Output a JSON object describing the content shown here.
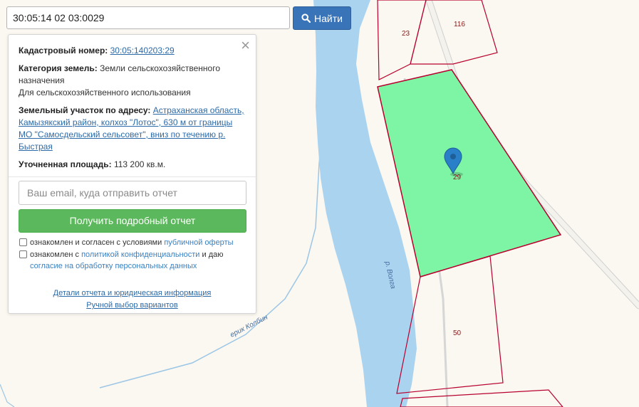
{
  "search": {
    "value": "30:05:14 02 03:0029",
    "button_label": "Найти"
  },
  "card": {
    "cadastral_label": "Кадастровый номер:",
    "cadastral_number": "30:05:140203:29",
    "category_label": "Категория земель:",
    "category_value": "Земли сельскохозяйственного назначения",
    "usage": "Для сельскохозяйственного использования",
    "address_label": "Земельный участок по адресу:",
    "address_value": "Астраханская область, Камызякский район, колхоз \"Лотос\", 630 м от границы МО \"Самосдельский сельсовет\", вниз по течению р. Быстрая",
    "area_label": "Уточненная площадь:",
    "area_value": "113 200 кв.м.",
    "email_placeholder": "Ваш email, куда отправить отчет",
    "report_button": "Получить подробный отчет",
    "consent1_prefix": "ознакомлен и согласен с условиями",
    "consent1_link": "публичной оферты",
    "consent2_prefix": "ознакомлен с",
    "consent2_link": "политикой конфиденциальности",
    "consent2_mid": "и даю",
    "consent2_link2": "согласие на обработку персональных данных",
    "details_link": "Детали отчета и юридическая информация",
    "manual_link": "Ручной выбор вариантов"
  },
  "map": {
    "parcel_labels": [
      "23",
      "116",
      "29",
      "50"
    ],
    "water_labels": [
      "р. Волга",
      "ерик Колбин"
    ],
    "colors": {
      "land": "#fbf8f1",
      "water": "#aad3f0",
      "selected_parcel": "#7ef5a5",
      "parcel_border": "#b8002e",
      "marker": "#2a7fc9"
    }
  }
}
